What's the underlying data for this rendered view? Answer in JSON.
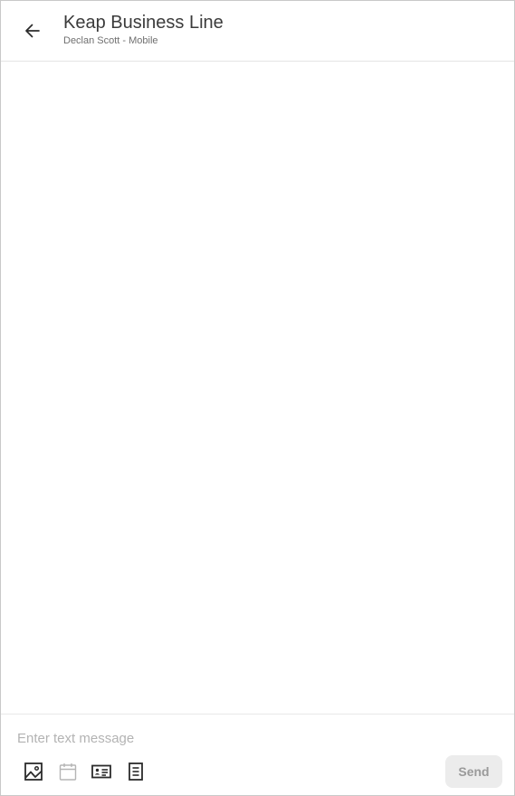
{
  "header": {
    "title": "Keap Business Line",
    "subtitle": "Declan Scott - Mobile",
    "back_icon": "arrow-left-icon"
  },
  "composer": {
    "placeholder": "Enter text message",
    "value": "",
    "tools": [
      {
        "icon": "image-icon",
        "state": "enabled"
      },
      {
        "icon": "calendar-icon",
        "state": "disabled"
      },
      {
        "icon": "contact-card-icon",
        "state": "enabled"
      },
      {
        "icon": "document-icon",
        "state": "enabled"
      }
    ],
    "send_label": "Send",
    "send_state": "disabled"
  },
  "colors": {
    "icon_active": "#2b2b2b",
    "icon_disabled": "#b5b5b5",
    "send_bg": "#ececec",
    "send_text": "#9a9a9a"
  }
}
